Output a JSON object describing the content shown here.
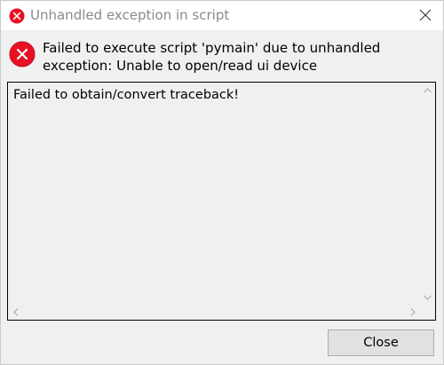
{
  "window": {
    "title": "Unhandled exception in script",
    "title_icon": "error-icon",
    "close_icon": "close-icon"
  },
  "message": {
    "icon": "error-icon",
    "text": "Failed to execute script 'pymain' due to unhandled exception: Unable to open/read ui device"
  },
  "traceback": {
    "text": "Failed to obtain/convert traceback!"
  },
  "buttons": {
    "close_label": "Close"
  },
  "colors": {
    "error_red": "#e81123",
    "title_text": "#8a8a8a",
    "button_bg": "#e1e1e1",
    "dialog_bg": "#f0f0f0"
  }
}
